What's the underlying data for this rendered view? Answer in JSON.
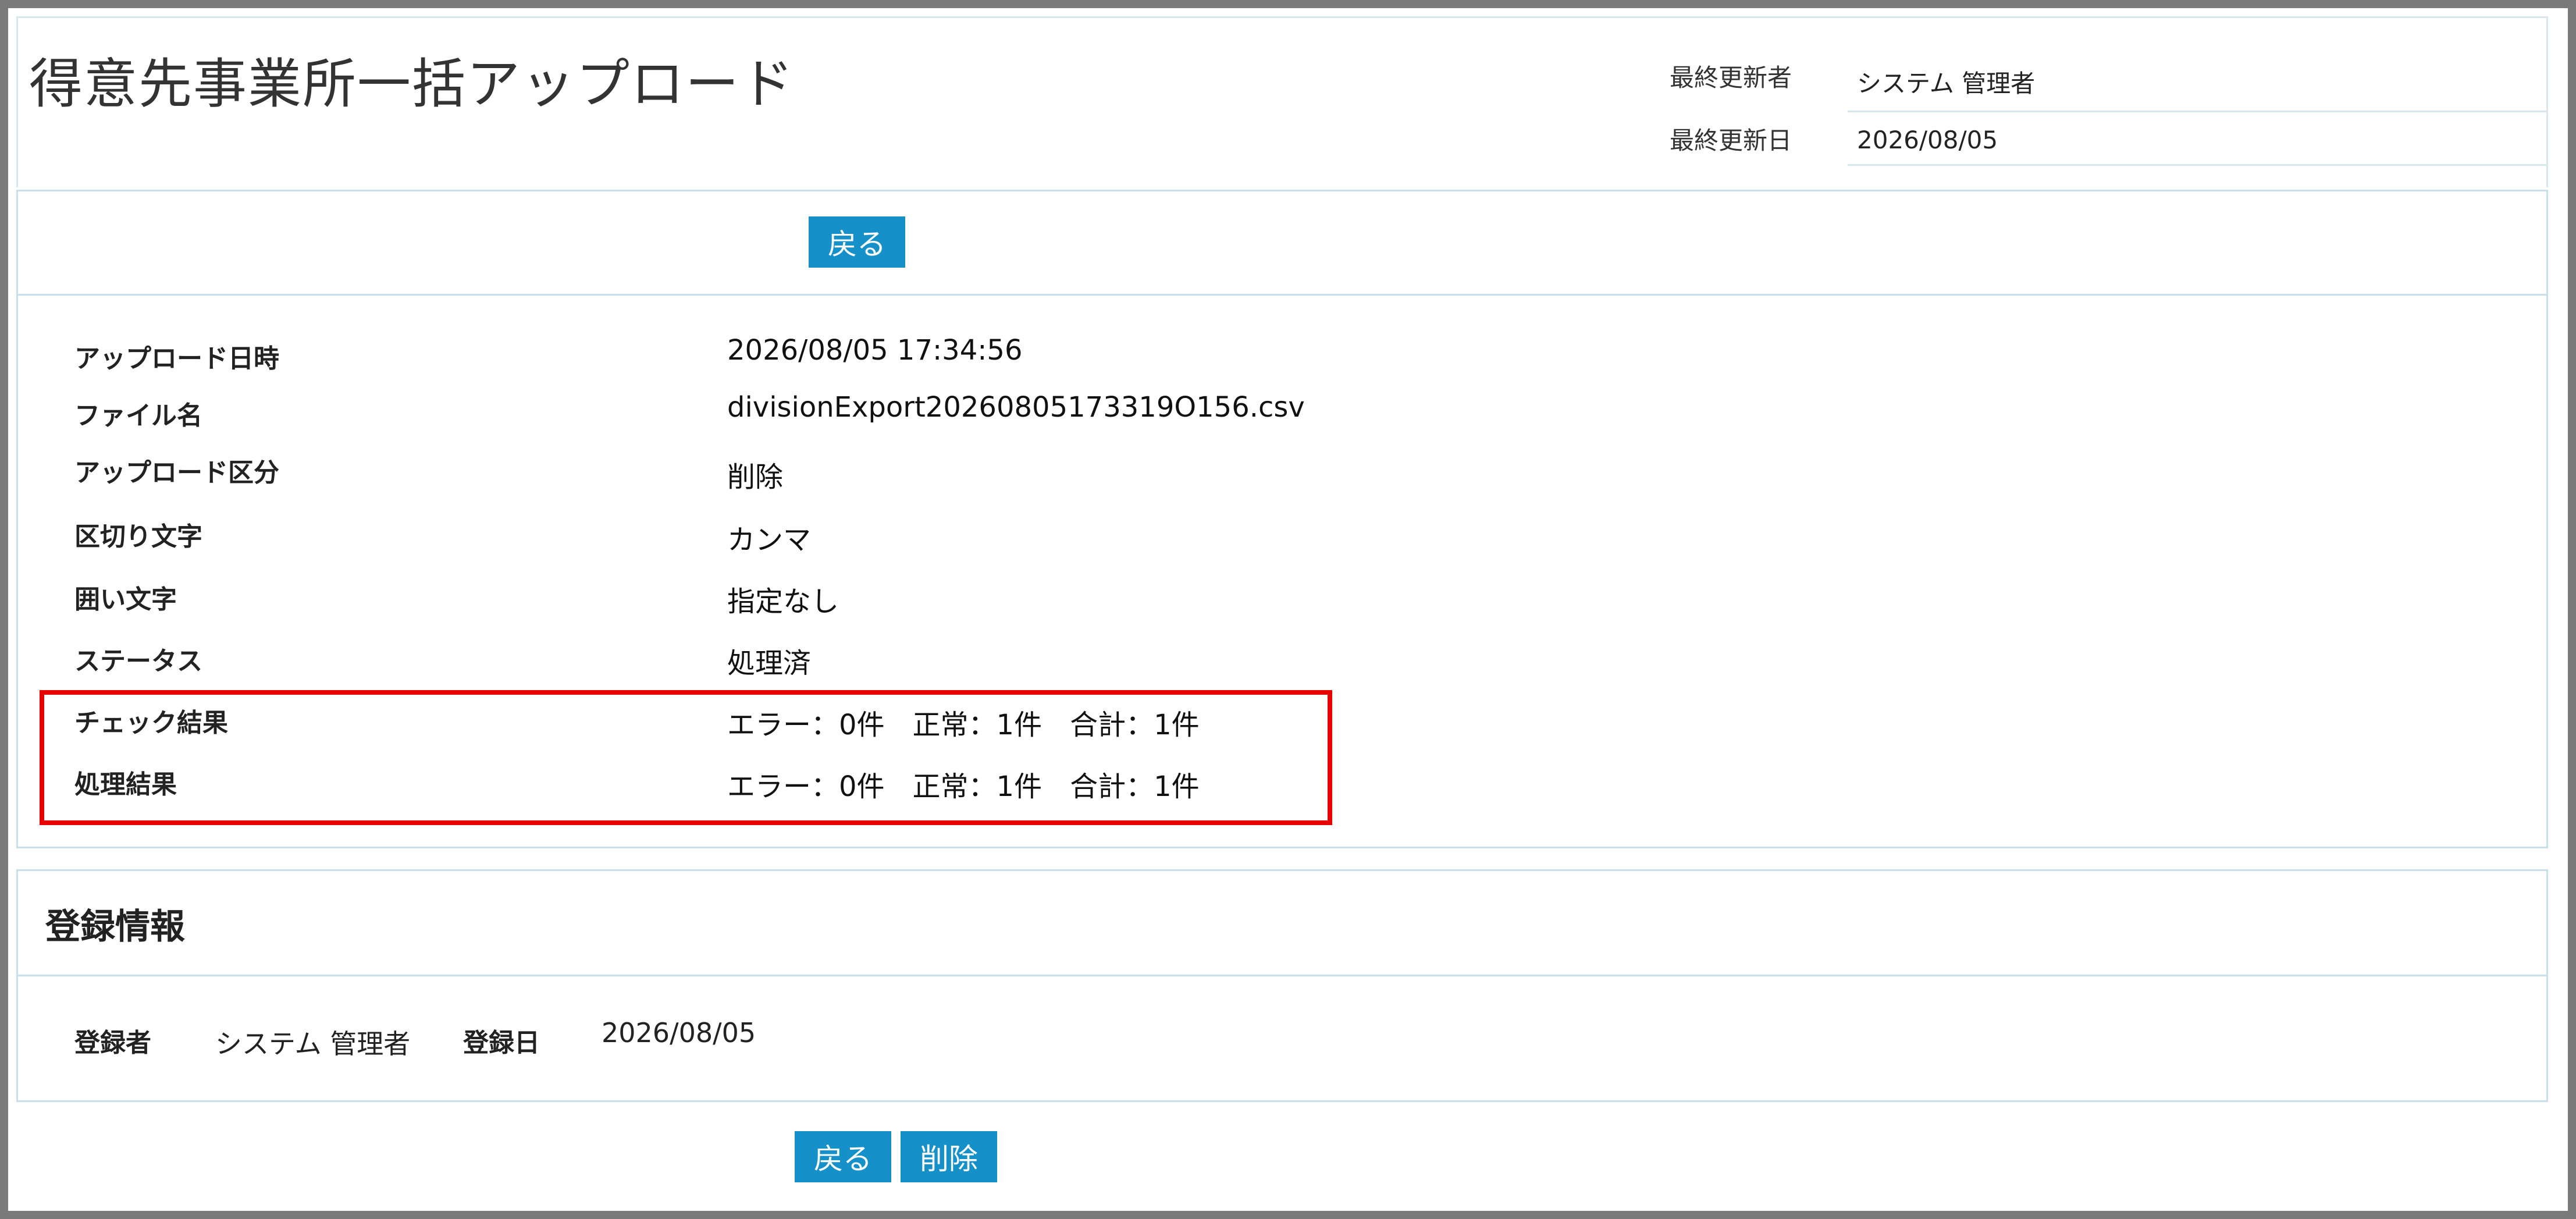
{
  "header": {
    "title": "得意先事業所一括アップロード",
    "last_updated_by_label": "最終更新者",
    "last_updated_by_value": "システム 管理者",
    "last_updated_date_label": "最終更新日",
    "last_updated_date_value": "2026/08/05"
  },
  "top_toolbar": {
    "back_label": "戻る"
  },
  "details": {
    "rows": [
      {
        "label": "アップロード日時",
        "value": "2026/08/05 17:34:56"
      },
      {
        "label": "ファイル名",
        "value": "divisionExport20260805173319O156.csv"
      },
      {
        "label": "アップロード区分",
        "value": "削除"
      },
      {
        "label": "区切り文字",
        "value": "カンマ"
      },
      {
        "label": "囲い文字",
        "value": "指定なし"
      },
      {
        "label": "ステータス",
        "value": "処理済"
      },
      {
        "label": "チェック結果",
        "value": "エラー：0件　正常：1件　合計：1件"
      },
      {
        "label": "処理結果",
        "value": "エラー：0件　正常：1件　合計：1件"
      }
    ]
  },
  "registration": {
    "section_title": "登録情報",
    "registered_by_label": "登録者",
    "registered_by_value": "システム 管理者",
    "registered_date_label": "登録日",
    "registered_date_value": "2026/08/05"
  },
  "bottom_toolbar": {
    "back_label": "戻る",
    "delete_label": "削除"
  },
  "colors": {
    "button_bg": "#1590c9",
    "highlight_border": "#e60000",
    "panel_border": "#c9dfeb"
  }
}
